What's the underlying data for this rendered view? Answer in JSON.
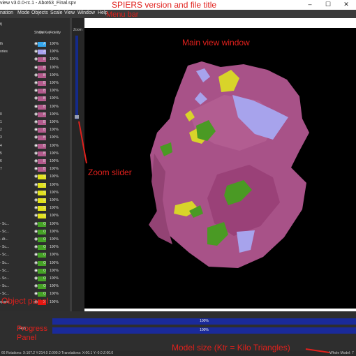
{
  "window": {
    "title": "view v3.0.0-rc.1 - Abot63_Final.spv",
    "minimize": "–",
    "maximize": "☐",
    "close": "✕"
  },
  "menu": [
    "nation",
    "Mode",
    "Objects",
    "Scale",
    "View",
    "Window",
    "Help"
  ],
  "annotations": {
    "version": "SPIERS version and file title",
    "menubar": "Menu bar",
    "mainview": "Main view window",
    "zoom": "Zoom slider",
    "objpanel": "Object panel",
    "progress1": "Progress",
    "progress2": "Panel",
    "modelsize": "Model size (Ktr = Kilo Triangles)"
  },
  "object_panel": {
    "title": "t)",
    "headers": {
      "show": "Show",
      "key": "Key",
      "col": "Col",
      "fidelity": "Fidelity"
    },
    "rows": [
      {
        "name": "th",
        "key": "A",
        "fid": "100%",
        "color": "#35a8f0"
      },
      {
        "name": "ories",
        "key": "A",
        "fid": "100%",
        "color": "#a9a3f0"
      },
      {
        "name": "",
        "key": "B",
        "fid": "100%",
        "color": "#b35a8c"
      },
      {
        "name": "",
        "key": "B",
        "fid": "100%",
        "color": "#b35a8c"
      },
      {
        "name": "",
        "key": "B",
        "fid": "100%",
        "color": "#b35a8c"
      },
      {
        "name": "",
        "key": "B",
        "fid": "100%",
        "color": "#b35a8c"
      },
      {
        "name": "",
        "key": "B",
        "fid": "100%",
        "color": "#b35a8c"
      },
      {
        "name": "",
        "key": "B",
        "fid": "100%",
        "color": "#b35a8c"
      },
      {
        "name": "",
        "key": "B",
        "fid": "100%",
        "color": "#b35a8c"
      },
      {
        "name": "0",
        "key": "B",
        "fid": "100%",
        "color": "#b35a8c"
      },
      {
        "name": "1",
        "key": "B",
        "fid": "100%",
        "color": "#b35a8c"
      },
      {
        "name": "2",
        "key": "B",
        "fid": "100%",
        "color": "#b35a8c"
      },
      {
        "name": "3",
        "key": "B",
        "fid": "100%",
        "color": "#b35a8c"
      },
      {
        "name": "4",
        "key": "B",
        "fid": "100%",
        "color": "#b35a8c"
      },
      {
        "name": "5",
        "key": "B",
        "fid": "100%",
        "color": "#b35a8c"
      },
      {
        "name": "6",
        "key": "B",
        "fid": "100%",
        "color": "#b35a8c"
      },
      {
        "name": "7",
        "key": "B",
        "fid": "100%",
        "color": "#b35a8c"
      },
      {
        "name": "",
        "key": "S",
        "fid": "100%",
        "color": "#e2e21c"
      },
      {
        "name": "",
        "key": "S",
        "fid": "100%",
        "color": "#e2e21c"
      },
      {
        "name": "",
        "key": "S",
        "fid": "100%",
        "color": "#e2e21c"
      },
      {
        "name": "",
        "key": "S",
        "fid": "100%",
        "color": "#e2e21c"
      },
      {
        "name": "",
        "key": "S",
        "fid": "100%",
        "color": "#e2e21c"
      },
      {
        "name": "",
        "key": "S",
        "fid": "100%",
        "color": "#e2e21c"
      },
      {
        "name": "- Sc...",
        "key": "O",
        "fid": "100%",
        "color": "#45a325"
      },
      {
        "name": "- Sc...",
        "key": "O",
        "fid": "100%",
        "color": "#45a325"
      },
      {
        "name": "- At...",
        "key": "O",
        "fid": "100%",
        "color": "#45a325"
      },
      {
        "name": "- Sc...",
        "key": "O",
        "fid": "100%",
        "color": "#45a325"
      },
      {
        "name": "- Sc...",
        "key": "O",
        "fid": "100%",
        "color": "#45a325"
      },
      {
        "name": "- Sc...",
        "key": "O",
        "fid": "100%",
        "color": "#45a325"
      },
      {
        "name": "- Sc...",
        "key": "O",
        "fid": "100%",
        "color": "#45a325"
      },
      {
        "name": "- Sc...",
        "key": "O",
        "fid": "100%",
        "color": "#45a325"
      },
      {
        "name": "- Sc...",
        "key": "O",
        "fid": "100%",
        "color": "#45a325"
      },
      {
        "name": "- Sc...",
        "key": "O",
        "fid": "100%",
        "color": "#45a325"
      },
      {
        "name": "quare",
        "key": "X",
        "fid": "100%",
        "color": "#e8140e"
      }
    ]
  },
  "zoom": {
    "label": "Zoom"
  },
  "progress": {
    "label": "7455",
    "bar1": "100%",
    "bar2": "100%"
  },
  "status": {
    "left": "66   Rotations: X:167.2 Y:214.0 Z:000.0   Translations: X:00.1 Y:-0.0 Z:00.0",
    "right": "Whole Model: 7"
  }
}
